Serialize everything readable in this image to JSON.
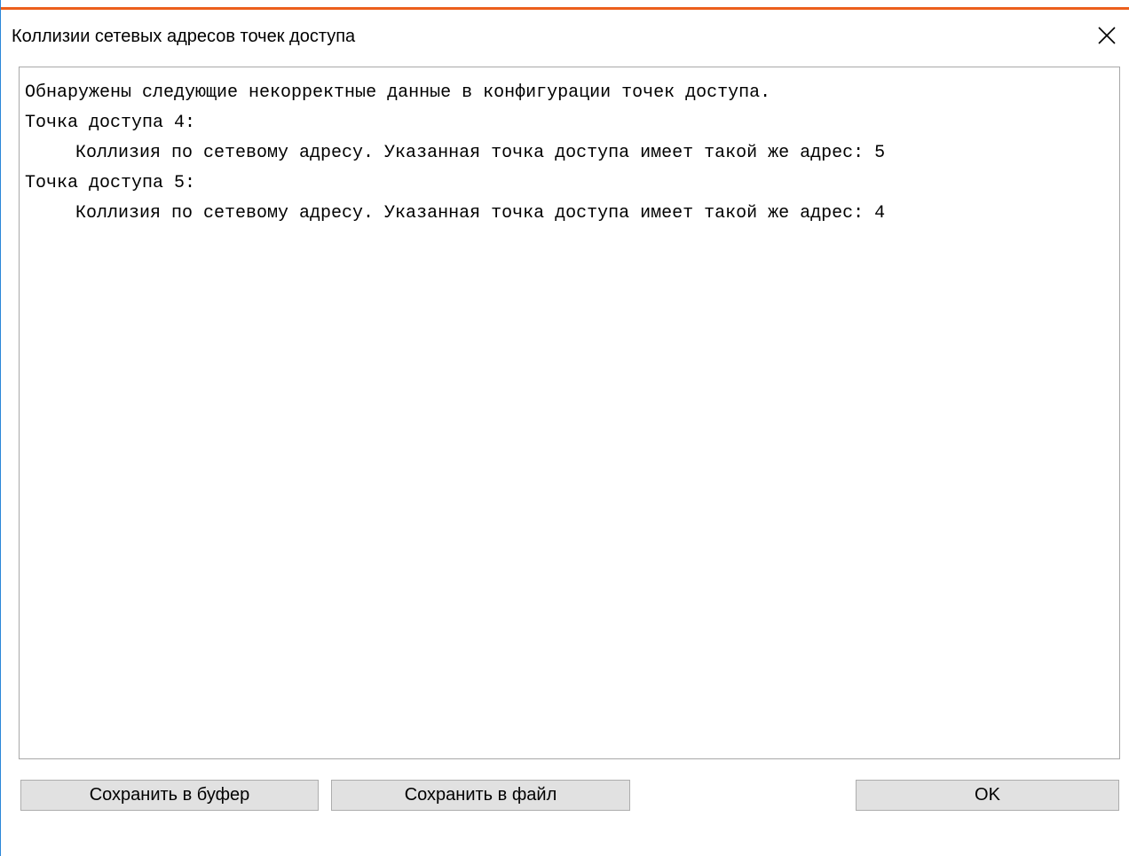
{
  "window": {
    "title": "Коллизии сетевых адресов точек доступа",
    "accent_color": "#ec5f1c",
    "border_color": "#2b86d8",
    "close_icon": "close-icon"
  },
  "report": {
    "lines": [
      {
        "text": "Обнаружены следующие некорректные данные в конфигурации точек доступа.",
        "indent": false
      },
      {
        "text": "Точка доступа 4:",
        "indent": false
      },
      {
        "text": "Коллизия по сетевому адресу. Указанная точка доступа имеет такой же адрес: 5",
        "indent": true
      },
      {
        "text": "Точка доступа 5:",
        "indent": false
      },
      {
        "text": "Коллизия по сетевому адресу. Указанная точка доступа имеет такой же адрес: 4",
        "indent": true
      }
    ]
  },
  "buttons": {
    "save_clipboard": "Сохранить в буфер",
    "save_file": "Сохранить в файл",
    "ok": "OK"
  }
}
